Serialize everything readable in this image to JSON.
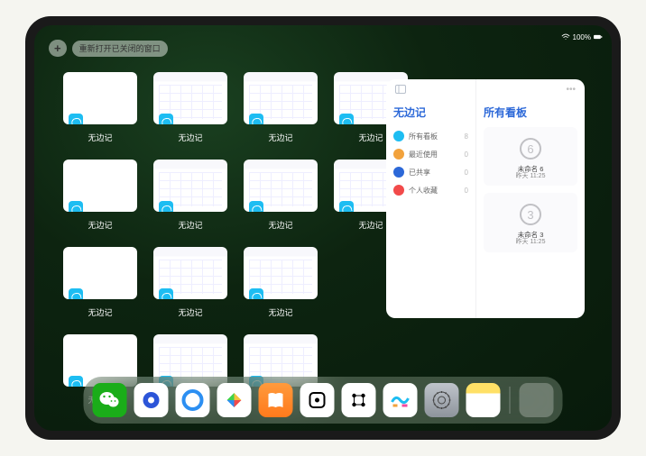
{
  "status": {
    "battery": "100%"
  },
  "toolbar": {
    "plus_label": "+",
    "reopen_label": "重新打开已关闭的窗口"
  },
  "window_app_name": "无边记",
  "window_grid": [
    [
      "blank",
      "cal",
      "cal",
      "cal"
    ],
    [
      "blank",
      "cal",
      "cal",
      "cal"
    ],
    [
      "blank",
      "cal",
      "cal",
      null
    ],
    [
      "blank",
      "cal",
      "cal",
      null
    ]
  ],
  "main_window": {
    "sidebar_title": "无边记",
    "panel_title": "所有看板",
    "items": [
      {
        "icon_color": "#1dbdf2",
        "label": "所有看板",
        "count": "8"
      },
      {
        "icon_color": "#f2a23c",
        "label": "最近使用",
        "count": "0"
      },
      {
        "icon_color": "#2c68d8",
        "label": "已共享",
        "count": "0"
      },
      {
        "icon_color": "#f24a4a",
        "label": "个人收藏",
        "count": "0"
      }
    ],
    "boards": [
      {
        "title": "未命名 6",
        "time": "昨天 11:25",
        "digit": "6"
      },
      {
        "title": "未命名 3",
        "time": "昨天 11:25",
        "digit": "3"
      }
    ]
  },
  "dock": {
    "apps": [
      {
        "name": "wechat",
        "bg": "#1aad19"
      },
      {
        "name": "quark",
        "bg": "#ffffff"
      },
      {
        "name": "qqbrowser",
        "bg": "#ffffff"
      },
      {
        "name": "play",
        "bg": "#ffffff"
      },
      {
        "name": "books",
        "bg": "linear-gradient(#ff9a3c,#ff7a1c)"
      },
      {
        "name": "dice",
        "bg": "#ffffff"
      },
      {
        "name": "grid-icon",
        "bg": "#ffffff"
      },
      {
        "name": "freeform",
        "bg": "#ffffff"
      },
      {
        "name": "settings",
        "bg": "linear-gradient(#bfc4cb,#8e949c)"
      },
      {
        "name": "notes",
        "bg": "linear-gradient(#ffe066 0 30%,#ffffff 30%)"
      }
    ]
  }
}
